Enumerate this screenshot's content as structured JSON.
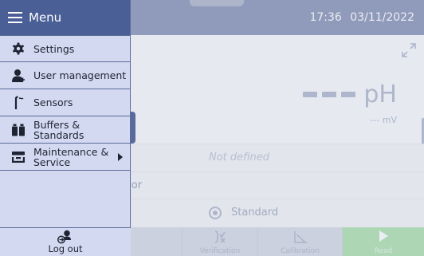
{
  "header": {
    "time": "17:36",
    "date": "03/11/2022"
  },
  "measurement": {
    "value_placeholder": "---",
    "unit": "pH",
    "mv_reading": "--- mV"
  },
  "info_rows": {
    "not_defined": "Not defined",
    "sensor_partial": "sor",
    "standard_option": "Standard"
  },
  "bottom_bar": {
    "verification": "Verification",
    "calibration": "Calibration",
    "read": "Read"
  },
  "menu": {
    "title": "Menu",
    "items": [
      {
        "label": "Settings",
        "icon": "gear-icon"
      },
      {
        "label": "User management",
        "icon": "user-icon"
      },
      {
        "label": "Sensors",
        "icon": "sensor-icon"
      },
      {
        "label": "Buffers & Standards",
        "icon": "buffers-icon"
      },
      {
        "label": "Maintenance & Service",
        "icon": "maintenance-icon",
        "has_submenu": true
      }
    ],
    "logout": {
      "label": "Log out",
      "icon": "logout-icon"
    }
  },
  "colors": {
    "header": "#4a5f96",
    "drawer": "#d3d9f1",
    "read_button": "#8fd78f"
  }
}
